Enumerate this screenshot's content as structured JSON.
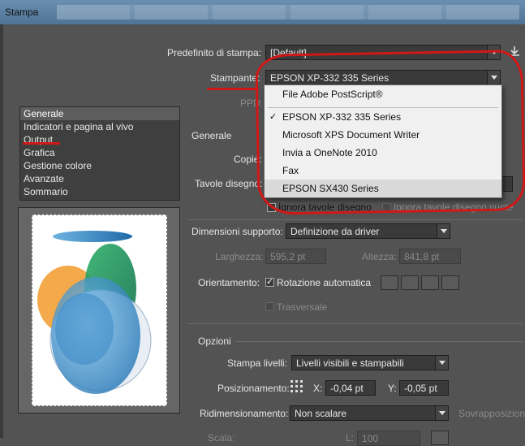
{
  "window": {
    "title": "Stampa"
  },
  "top": {
    "preset_label": "Predefinito di stampa:",
    "preset_value": "[Default]",
    "printer_label": "Stampante:",
    "printer_value": "EPSON XP-332 335 Series",
    "ppd_label": "PPD:"
  },
  "printer_dropdown": {
    "options": [
      "File Adobe PostScript®",
      "EPSON XP-332 335 Series",
      "Microsoft XPS Document Writer",
      "Invia a OneNote 2010",
      "Fax",
      "EPSON SX430 Series"
    ],
    "selected": "EPSON XP-332 335 Series"
  },
  "sidebar": {
    "items": [
      "Generale",
      "Indicatori e pagina al vivo",
      "Output",
      "Grafica",
      "Gestione colore",
      "Avanzate",
      "Sommario"
    ],
    "selected": "Generale"
  },
  "general": {
    "header": "Generale",
    "copies_label": "Copie:",
    "artboards_label": "Tavole disegno:",
    "ignore_artboards": "Ignora tavole disegno",
    "ignore_empty": "Ignora tavole disegno vuote"
  },
  "media": {
    "size_label": "Dimensioni supporto:",
    "size_value": "Definizione da driver",
    "width_label": "Larghezza:",
    "width_value": "595,2 pt",
    "height_label": "Altezza:",
    "height_value": "841,8 pt",
    "orientation_label": "Orientamento:",
    "auto_rotate": "Rotazione automatica",
    "transverse": "Trasversale"
  },
  "options": {
    "header": "Opzioni",
    "layers_label": "Stampa livelli:",
    "layers_value": "Livelli visibili e stampabili",
    "placement_label": "Posizionamento:",
    "x_label": "X:",
    "x_value": "-0,04 pt",
    "y_label": "Y:",
    "y_value": "-0,05 pt",
    "scaling_label": "Ridimensionamento:",
    "scaling_value": "Non scalare",
    "overlap_label": "Sovrapposizione",
    "scale_label": "Scala:",
    "scale_w_label": "L:",
    "scale_w_value": "100"
  },
  "colors": {
    "annotation_red": "#d01818",
    "preview_blue": "#2f7fbf",
    "preview_green": "#1a8a55",
    "preview_orange": "#f2a540"
  }
}
